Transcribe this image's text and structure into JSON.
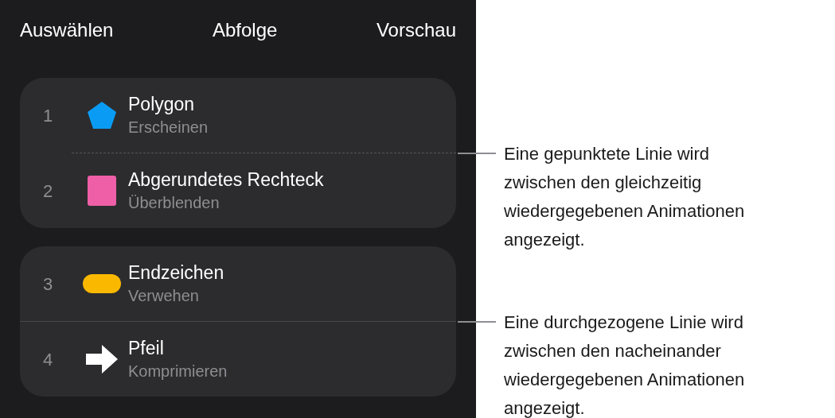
{
  "header": {
    "left_button": "Auswählen",
    "title": "Abfolge",
    "right_button": "Vorschau"
  },
  "groups": [
    {
      "kind": "dashed",
      "callout": "Eine gepunktete Linie wird zwischen den gleichzeitig wiedergegebenen Animationen angezeigt.",
      "items": [
        {
          "number": "1",
          "title": "Polygon",
          "effect": "Erscheinen",
          "kind": "pentagon",
          "color": "#0a9cf5"
        },
        {
          "number": "2",
          "title": "Abgerundetes Rechteck",
          "effect": "Überblenden",
          "kind": "square",
          "color": "#ef5fa7"
        }
      ]
    },
    {
      "kind": "solid",
      "callout": "Eine durchgezogene Linie wird zwischen den nacheinander wiedergegebenen Animationen angezeigt.",
      "items": [
        {
          "number": "3",
          "title": "Endzeichen",
          "effect": "Verwehen",
          "kind": "pill",
          "color": "#fbb800"
        },
        {
          "number": "4",
          "title": "Pfeil",
          "effect": "Komprimieren",
          "kind": "arrow",
          "color": "#ffffff"
        }
      ]
    }
  ]
}
